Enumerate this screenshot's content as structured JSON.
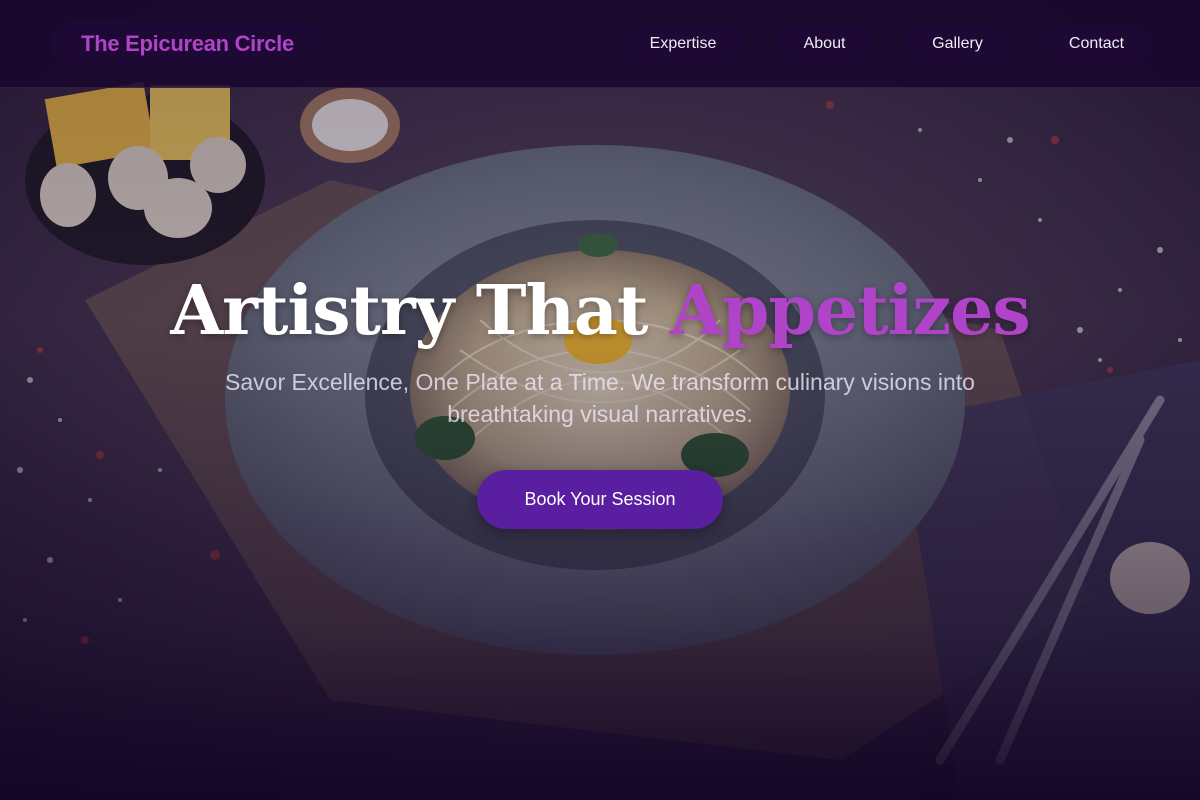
{
  "brand": {
    "name": "The Epicurean Circle"
  },
  "nav": {
    "items": [
      {
        "label": "Expertise"
      },
      {
        "label": "About"
      },
      {
        "label": "Gallery"
      },
      {
        "label": "Contact"
      }
    ]
  },
  "hero": {
    "title_main": "Artistry That",
    "title_accent": "Appetizes",
    "subtitle": "Savor Excellence, One Plate at a Time. We transform culinary visions into breathtaking visual narratives.",
    "cta_label": "Book Your Session"
  },
  "colors": {
    "accent": "#b044c8",
    "cta": "#5a1fa0",
    "header_bg": "#18062c"
  }
}
